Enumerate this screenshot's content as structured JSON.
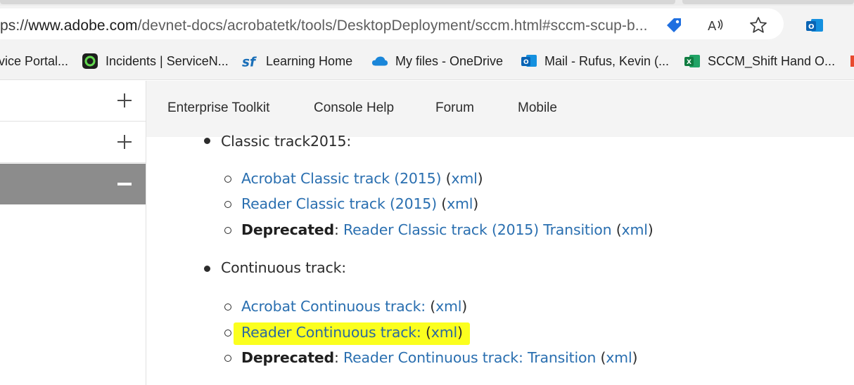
{
  "browser": {
    "url_scheme_tail": "ps://",
    "url_host": "www.adobe.com",
    "url_path": "/devnet-docs/acrobatetk/tools/DesktopDeployment/sccm.html#sccm-scup-b...",
    "icons": [
      "tag-icon",
      "read-aloud-icon",
      "favorite-star-icon",
      "outlook-icon"
    ]
  },
  "bookmarks": [
    {
      "label": "vice Portal...",
      "icon": "service-portal-icon"
    },
    {
      "label": "Incidents | ServiceN...",
      "icon": "servicenow-icon"
    },
    {
      "label": "Learning Home",
      "icon": "successfactors-icon"
    },
    {
      "label": "My files - OneDrive",
      "icon": "onedrive-icon"
    },
    {
      "label": "Mail - Rufus, Kevin (...",
      "icon": "outlook-icon"
    },
    {
      "label": "SCCM_Shift Hand O...",
      "icon": "excel-icon"
    }
  ],
  "topnav": {
    "items": [
      "Enterprise Toolkit",
      "Console Help",
      "Forum",
      "Mobile"
    ]
  },
  "content": {
    "classic_heading": "Classic track2015:",
    "classic_items": [
      {
        "prefix": "",
        "link": "Acrobat Classic track (2015)",
        "xml": "xml"
      },
      {
        "prefix": "",
        "link": "Reader Classic track (2015)",
        "xml": "xml"
      },
      {
        "prefix": "Deprecated",
        "link": "Reader Classic track (2015) Transition",
        "xml": "xml"
      }
    ],
    "continuous_heading": "Continuous track:",
    "continuous_items": [
      {
        "prefix": "",
        "link": "Acrobat Continuous track:",
        "xml": "xml"
      },
      {
        "prefix": "",
        "link": "Reader Continuous track:",
        "xml": "xml"
      },
      {
        "prefix": "Deprecated",
        "link": "Reader Continuous track: Transition",
        "xml": "xml"
      }
    ],
    "highlight_color": "#fbff1e",
    "link_color": "#2a6fb0"
  }
}
